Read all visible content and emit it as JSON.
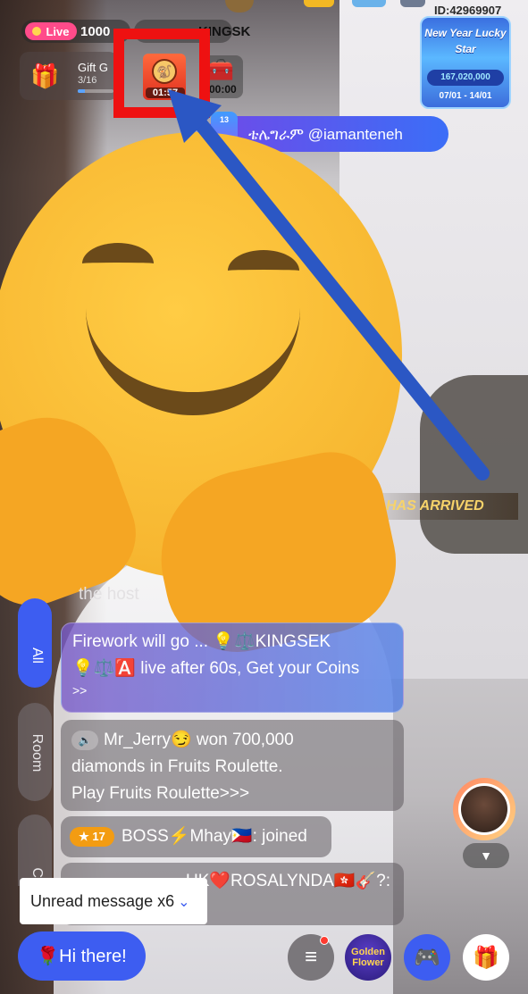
{
  "header": {
    "user_id": "ID:42969907",
    "live_label": "Live",
    "viewer_count": "1000",
    "host_tag": "KINGSK"
  },
  "gift_goal": {
    "title": "Gift G",
    "progress_text": "3/16",
    "progress": 0.19
  },
  "red_packet": {
    "timer": "01:57"
  },
  "treasure": {
    "timer": "00:00"
  },
  "event_card": {
    "title": "New Year Lucky Star",
    "amount": "167,020,000",
    "dates": "07/01 - 14/01"
  },
  "telegram_banner": {
    "text": "ቴሌግራም @iamanteneh",
    "icon_text": "13"
  },
  "arrival_banner": {
    "text": "HAS ARRIVED"
  },
  "welcome": {
    "text": "the host"
  },
  "tabs": [
    {
      "label": "All",
      "active": true
    },
    {
      "label": "Room",
      "active": false
    },
    {
      "label": "Cha",
      "active": false
    }
  ],
  "messages": {
    "firework": {
      "line1": "Firework will go ... 💡⚖️KINGSEK",
      "line2": "💡⚖️🅰️ live after 60s, Get your Coins",
      "line3": ">>"
    },
    "jerry": {
      "speaker": "🔈",
      "line1": "Mr_Jerry😏 won 700,000",
      "line2": "diamonds in Fruits Roulette.",
      "line3": "Play Fruits Roulette>>>"
    },
    "boss": {
      "level": "17",
      "text": "BOSS⚡Mhay🇵🇭: joined"
    },
    "rosalynda": {
      "text": "UK❤️ROSALYNDA🇭🇰🎸?:"
    }
  },
  "unread": {
    "text": "Unread message x6",
    "chevron": "⌄"
  },
  "viewer": {
    "collapse_icon": "▼"
  },
  "bottom_bar": {
    "hi_button": "🌹Hi there!",
    "menu_icon": "≡",
    "golden_label": "Golden Flower",
    "game_icon": "🎮",
    "gift_icon": "🎁"
  },
  "colors": {
    "accent_blue": "#3d5df1",
    "highlight_red": "#ee1111",
    "arrow_blue": "#2b57c4",
    "live_pink": "#ff4b8a"
  }
}
